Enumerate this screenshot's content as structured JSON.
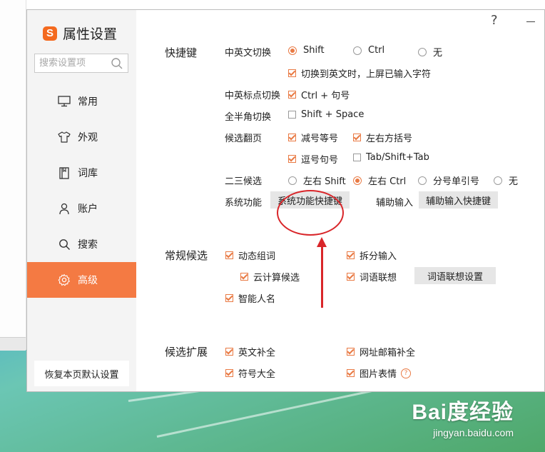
{
  "app": {
    "logo_letter": "S",
    "title": "属性设置"
  },
  "window_controls": {
    "help": "?"
  },
  "search": {
    "placeholder": "搜索设置项"
  },
  "nav": [
    {
      "label": "常用",
      "icon": "monitor-icon"
    },
    {
      "label": "外观",
      "icon": "shirt-icon"
    },
    {
      "label": "词库",
      "icon": "book-icon"
    },
    {
      "label": "账户",
      "icon": "user-icon"
    },
    {
      "label": "搜索",
      "icon": "search-icon"
    },
    {
      "label": "高级",
      "icon": "gear-icon",
      "active": true
    }
  ],
  "restore_label": "恢复本页默认设置",
  "sections": {
    "shortcuts": {
      "title": "快捷键",
      "cn_en_switch": {
        "label": "中英文切换",
        "options": [
          "Shift",
          "Ctrl",
          "无"
        ],
        "selected": "Shift",
        "commit_on_switch": {
          "label": "切换到英文时，上屏已输入字符",
          "checked": true
        }
      },
      "punct_switch": {
        "label": "中英标点切换",
        "option": "Ctrl + 句号",
        "checked": true
      },
      "width_switch": {
        "label": "全半角切换",
        "option": "Shift + Space",
        "checked": false
      },
      "page_turn": {
        "label": "候选翻页",
        "options": [
          {
            "label": "减号等号",
            "checked": true
          },
          {
            "label": "左右方括号",
            "checked": true
          },
          {
            "label": "逗号句号",
            "checked": true
          },
          {
            "label": "Tab/Shift+Tab",
            "checked": false
          }
        ]
      },
      "second_third": {
        "label": "二三候选",
        "options": [
          "左右 Shift",
          "左右 Ctrl",
          "分号单引号",
          "无"
        ],
        "selected": "左右 Ctrl"
      },
      "system": {
        "label": "系统功能",
        "button": "系统功能快捷键"
      },
      "assist": {
        "label": "辅助输入",
        "button": "辅助输入快捷键"
      }
    },
    "candidates": {
      "title": "常规候选",
      "items": [
        {
          "label": "动态组词",
          "checked": true
        },
        {
          "label": "拆分输入",
          "checked": true
        },
        {
          "label": "云计算候选",
          "checked": true
        },
        {
          "label": "词语联想",
          "checked": true
        },
        {
          "label": "智能人名",
          "checked": true
        }
      ],
      "assoc_button": "词语联想设置"
    },
    "extensions": {
      "title": "候选扩展",
      "items": [
        {
          "label": "英文补全",
          "checked": true
        },
        {
          "label": "网址邮箱补全",
          "checked": true
        },
        {
          "label": "符号大全",
          "checked": true
        },
        {
          "label": "图片表情",
          "checked": true
        }
      ],
      "help_glyph": "?"
    }
  },
  "watermark": {
    "logo": "Bai度经验",
    "url": "jingyan.baidu.com"
  },
  "colors": {
    "accent": "#f47a43",
    "annotation": "#d9262a"
  }
}
